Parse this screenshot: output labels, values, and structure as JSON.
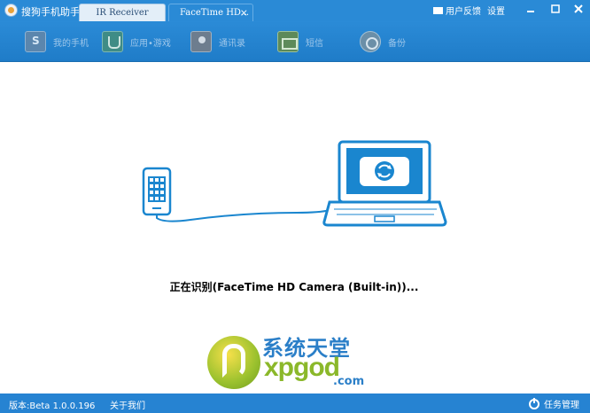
{
  "app": {
    "title": "搜狗手机助手"
  },
  "tabs": [
    {
      "label": "IR Receiver"
    },
    {
      "label": "FaceTime HD...",
      "close": "×"
    }
  ],
  "header": {
    "feedback": "用户反馈",
    "settings": "设置"
  },
  "nav": [
    {
      "label": "我的手机",
      "icon": "phone-icon"
    },
    {
      "label": "应用•游戏",
      "icon": "apps-icon"
    },
    {
      "label": "通讯录",
      "icon": "contacts-icon"
    },
    {
      "label": "短信",
      "icon": "sms-icon"
    },
    {
      "label": "备份",
      "icon": "backup-icon"
    }
  ],
  "main": {
    "status": "正在识别(FaceTime HD Camera (Built-in))..."
  },
  "watermark": {
    "cn": "系统天堂",
    "en": "xpgod",
    "com": ".com"
  },
  "statusbar": {
    "version": "版本:Beta 1.0.0.196",
    "about": "关于我们",
    "task_manager": "任务管理"
  },
  "colors": {
    "accent": "#2a8ad6",
    "illustration": "#1a86cf"
  }
}
